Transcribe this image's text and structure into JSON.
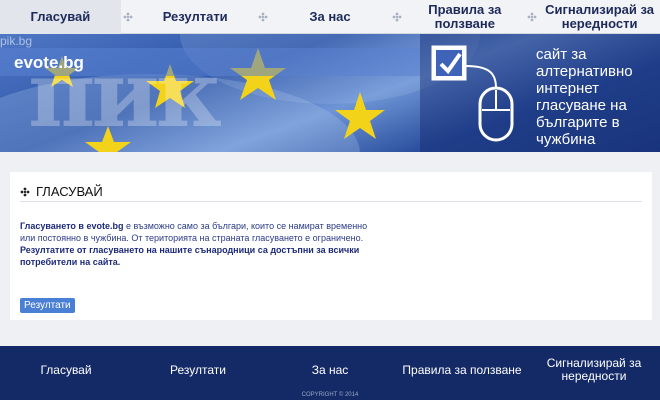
{
  "nav": {
    "items": [
      {
        "label": "Гласувай"
      },
      {
        "label": "Резултати"
      },
      {
        "label": "За нас"
      },
      {
        "label": "Правила за ползване"
      },
      {
        "label": "Сигнализирай за нередности"
      }
    ]
  },
  "banner": {
    "watermark_small": "pik.bg",
    "watermark_big": "пик",
    "domain": "evote.bg",
    "tagline": "сайт за алтернативно интернет гласуване на българите в чужбина"
  },
  "content": {
    "title": "ГЛАСУВАЙ",
    "para_lead": "Гласуването в evote.bg",
    "para_body": " е възможно само за българи, които се намират временно или постоянно в чужбина. От територията на страната гласуването е ограничено. ",
    "para_bold": "Резултатите от гласуването на нашите сънародници са достъпни за всички потребители на сайта.",
    "results_button": "Резултати"
  },
  "footer": {
    "items": [
      {
        "label": "Гласувай"
      },
      {
        "label": "Резултати"
      },
      {
        "label": "За нас"
      },
      {
        "label": "Правила за ползване"
      },
      {
        "label": "Сигнализирай за нередности"
      }
    ],
    "copyright": "COPYRIGHT © 2014"
  },
  "colors": {
    "nav_text": "#1d2a5a",
    "banner_blue": "#2e56a8",
    "star_yellow": "#f3d21a",
    "footer_bg": "#142a66",
    "button": "#4a7fd6"
  }
}
